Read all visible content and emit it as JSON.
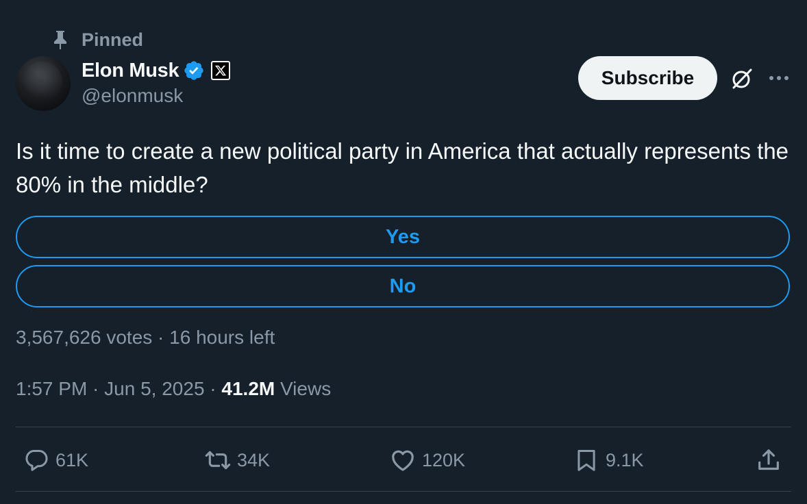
{
  "pinned": {
    "label": "Pinned",
    "icon": "pin-icon"
  },
  "author": {
    "name": "Elon Musk",
    "handle": "@elonmusk",
    "verified_icon": "verified-badge-icon",
    "affiliation_icon": "x-logo-icon"
  },
  "header_actions": {
    "subscribe_label": "Subscribe",
    "grok_icon": "grok-icon",
    "more_icon": "more-icon"
  },
  "tweet": {
    "text": "Is it time to create a new political party in America that actually represents the 80% in the middle?"
  },
  "poll": {
    "options": [
      {
        "label": "Yes"
      },
      {
        "label": "No"
      }
    ],
    "meta": "3,567,626 votes · 16 hours left"
  },
  "timestamp": {
    "time": "1:57 PM",
    "separator": " · ",
    "date": "Jun 5, 2025",
    "views_count": "41.2M",
    "views_label": " Views"
  },
  "actions": {
    "reply": {
      "count": "61K",
      "icon": "reply-icon"
    },
    "retweet": {
      "count": "34K",
      "icon": "retweet-icon"
    },
    "like": {
      "count": "120K",
      "icon": "heart-icon"
    },
    "bookmark": {
      "count": "9.1K",
      "icon": "bookmark-icon"
    },
    "share": {
      "icon": "share-icon"
    }
  },
  "colors": {
    "background": "#15202b",
    "accent": "#1d9bf0",
    "text_primary": "#f7f9f9",
    "text_secondary": "#8b98a5",
    "divider": "#38444d"
  }
}
